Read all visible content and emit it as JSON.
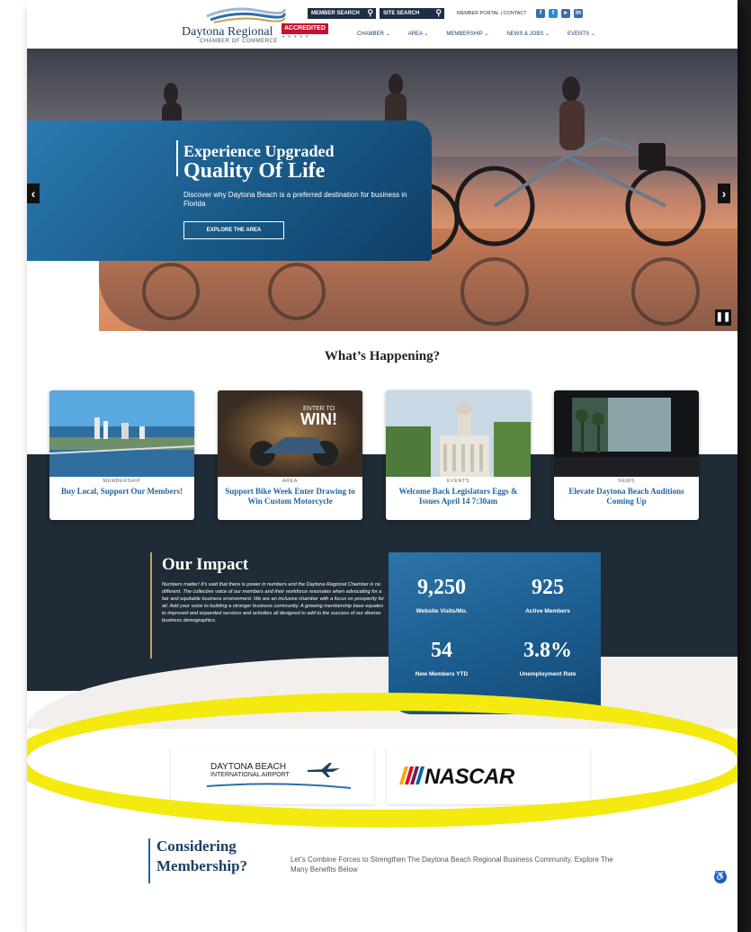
{
  "header": {
    "logo_name": "Daytona Regional",
    "logo_sub": "CHAMBER OF COMMERCE",
    "accredited": "ACCREDITED",
    "member_search": "MEMBER SEARCH",
    "site_search": "SITE SEARCH",
    "top_links": "MEMBER PORTAL  |  CONTACT",
    "nav": [
      "CHAMBER ⌄",
      "AREA ⌄",
      "MEMBERSHIP ⌄",
      "NEWS & JOBS ⌄",
      "EVENTS ⌄"
    ]
  },
  "hero": {
    "small": "Experience Upgraded",
    "big": "Quality Of Life",
    "desc": "Discover why Daytona Beach is a preferred destination for business in Florida",
    "button": "EXPLORE THE AREA",
    "prev": "‹",
    "next": "›",
    "pause": "❚❚"
  },
  "whats_happening": {
    "title": "What’s Happening?",
    "cards": [
      {
        "category": "MEMBERSHIP",
        "title": "Buy Local, Support Our Members!"
      },
      {
        "category": "AREA",
        "title": "Support Bike Week Enter Drawing to Win Custom Motorcycle",
        "image_text": "ENTER TO WIN!"
      },
      {
        "category": "EVENTS",
        "title": "Welcome Back Legislators Eggs & Issues April 14 7:30am"
      },
      {
        "category": "NEWS",
        "title": "Elevate Daytona Beach Auditions Coming Up"
      }
    ]
  },
  "impact": {
    "title": "Our Impact",
    "text": "Numbers matter! It’s said that there is power in numbers and the Daytona Regional Chamber is no different. The collective voice of our members and their workforce resonates when advocating for a fair and equitable business environment. We are an inclusive chamber with a focus on prosperity for all. Add your voice to building a stronger business community. A growing membership base equates to improved and expanded services and activities all designed to add to the success of our diverse business demographics.",
    "stats": [
      {
        "value": "9,250",
        "label": "Website Visits/Mo."
      },
      {
        "value": "925",
        "label": "Active Members"
      },
      {
        "value": "54",
        "label": "New Members YTD"
      },
      {
        "value": "3.8%",
        "label": "Unemployment Rate"
      }
    ]
  },
  "sponsors": {
    "airport_name": "DAYTONA BEACH",
    "airport_sub": "INTERNATIONAL AIRPORT",
    "nascar": "NASCAR"
  },
  "membership": {
    "title_line1": "Considering",
    "title_line2": "Membership?",
    "text": "Let’s Combine Forces to Strengthen The Daytona Beach Regional Business Community. Explore The Many Benefits Below"
  },
  "colors": {
    "brand_blue": "#1c64a8",
    "dark_navy": "#1f2b36",
    "highlight_yellow": "#f4ea10",
    "accredited_red": "#c4122f"
  }
}
